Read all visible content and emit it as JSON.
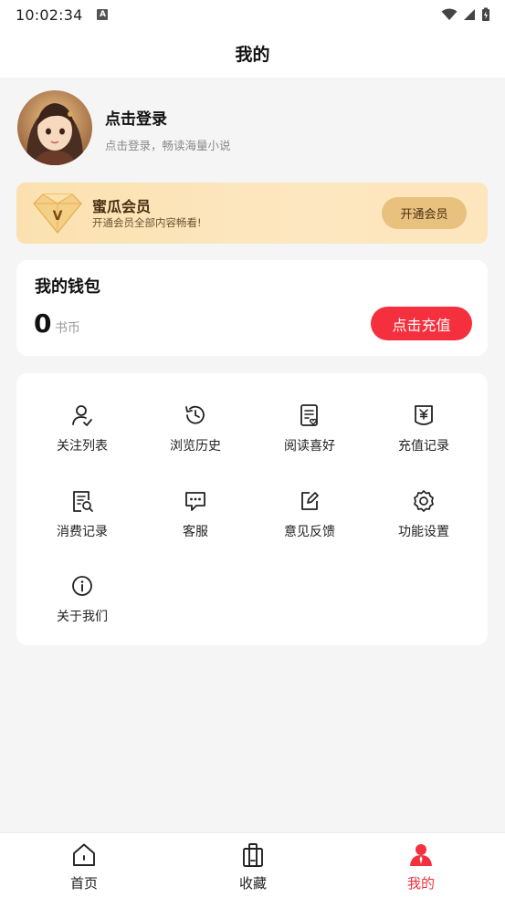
{
  "status_bar": {
    "time": "10:02:34",
    "a_badge": "A"
  },
  "header": {
    "title": "我的"
  },
  "profile": {
    "login_title": "点击登录",
    "login_subtitle": "点击登录，畅读海量小说"
  },
  "vip": {
    "title": "蜜瓜会员",
    "description": "开通会员全部内容畅看!",
    "button_label": "开通会员",
    "logo_letter": "V"
  },
  "wallet": {
    "title": "我的钱包",
    "amount": "0",
    "unit": "书币",
    "recharge_label": "点击充值"
  },
  "menu": {
    "items": [
      {
        "label": "关注列表",
        "icon": "user-check-icon"
      },
      {
        "label": "浏览历史",
        "icon": "history-clock-icon"
      },
      {
        "label": "阅读喜好",
        "icon": "reading-preference-icon"
      },
      {
        "label": "充值记录",
        "icon": "recharge-record-icon"
      },
      {
        "label": "消费记录",
        "icon": "consumption-record-icon"
      },
      {
        "label": "客服",
        "icon": "chat-bubble-icon"
      },
      {
        "label": "意见反馈",
        "icon": "feedback-edit-icon"
      },
      {
        "label": "功能设置",
        "icon": "gear-icon"
      },
      {
        "label": "关于我们",
        "icon": "info-icon"
      }
    ]
  },
  "bottom_nav": {
    "items": [
      {
        "label": "首页",
        "icon": "home-icon",
        "active": false
      },
      {
        "label": "收藏",
        "icon": "bookshelf-icon",
        "active": false
      },
      {
        "label": "我的",
        "icon": "profile-icon",
        "active": true
      }
    ]
  },
  "colors": {
    "accent_red": "#f5303e",
    "vip_gold": "#e8c17f",
    "vip_text": "#4a2f12",
    "page_bg": "#f5f5f5"
  }
}
